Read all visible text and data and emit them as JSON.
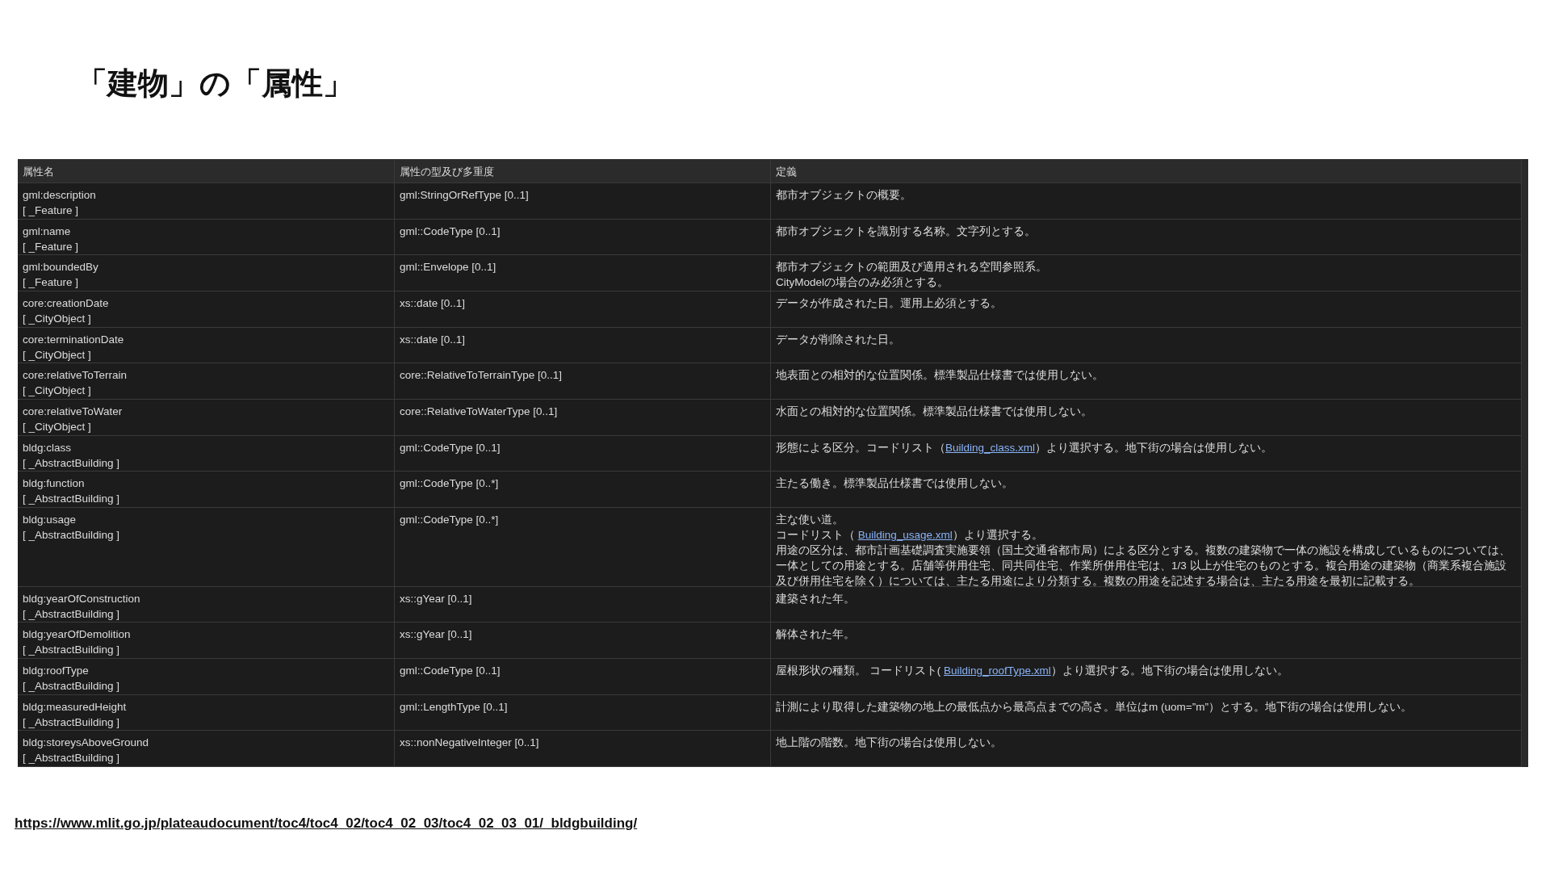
{
  "title": "「建物」の「属性」",
  "table": {
    "columns": [
      "属性名",
      "属性の型及び多重度",
      "定義"
    ],
    "rows": [
      {
        "name": "gml:description",
        "owner": "[ _Feature ]",
        "type": "gml:StringOrRefType [0..1]",
        "definition": [
          [
            {
              "text": "都市オブジェクトの概要。"
            }
          ]
        ]
      },
      {
        "name": "gml:name",
        "owner": "[ _Feature ]",
        "type": "gml::CodeType [0..1]",
        "definition": [
          [
            {
              "text": "都市オブジェクトを識別する名称。文字列とする。"
            }
          ]
        ]
      },
      {
        "name": "gml:boundedBy",
        "owner": "[ _Feature ]",
        "type": "gml::Envelope [0..1]",
        "definition": [
          [
            {
              "text": "都市オブジェクトの範囲及び適用される空間参照系。"
            }
          ],
          [
            {
              "text": "CityModelの場合のみ必須とする。"
            }
          ]
        ]
      },
      {
        "name": "core:creationDate",
        "owner": "[ _CityObject ]",
        "type": "xs::date [0..1]",
        "definition": [
          [
            {
              "text": "データが作成された日。運用上必須とする。"
            }
          ]
        ]
      },
      {
        "name": "core:terminationDate",
        "owner": "[ _CityObject ]",
        "type": "xs::date [0..1]",
        "definition": [
          [
            {
              "text": "データが削除された日。"
            }
          ]
        ]
      },
      {
        "name": "core:relativeToTerrain",
        "owner": "[ _CityObject ]",
        "type": "core::RelativeToTerrainType [0..1]",
        "definition": [
          [
            {
              "text": "地表面との相対的な位置関係。標準製品仕様書では使用しない。"
            }
          ]
        ]
      },
      {
        "name": "core:relativeToWater",
        "owner": "[ _CityObject ]",
        "type": "core::RelativeToWaterType [0..1]",
        "definition": [
          [
            {
              "text": "水面との相対的な位置関係。標準製品仕様書では使用しない。"
            }
          ]
        ]
      },
      {
        "name": "bldg:class",
        "owner": "[ _AbstractBuilding ]",
        "type": "gml::CodeType [0..1]",
        "definition": [
          [
            {
              "text": "形態による区分。コードリスト（"
            },
            {
              "text": "Building_class.xml",
              "kind": "link"
            },
            {
              "text": "）より選択する。地下街の場合は使用しない。"
            }
          ]
        ]
      },
      {
        "name": "bldg:function",
        "owner": "[ _AbstractBuilding ]",
        "type": "gml::CodeType [0..*]",
        "definition": [
          [
            {
              "text": "主たる働き。標準製品仕様書では使用しない。"
            }
          ]
        ]
      },
      {
        "name": "bldg:usage",
        "owner": "[ _AbstractBuilding ]",
        "type": "gml::CodeType [0..*]",
        "definition": [
          [
            {
              "text": "主な使い道。"
            }
          ],
          [
            {
              "text": "コードリスト（ "
            },
            {
              "text": "Building_usage.xml",
              "kind": "link"
            },
            {
              "text": "）より選択する。"
            }
          ],
          [
            {
              "text": "用途の区分は、都市計画基礎調査実施要領（国土交通省都市局）による区分とする。複数の建築物で一体の施設を構成しているものについては、一体としての用途とする。店舗等併用住宅、同共同住宅、作業所併用住宅は、1/3 以上が住宅のものとする。複合用途の建築物（商業系複合施設及び併用住宅を除く）については、主たる用途により分類する。複数の用途を記述する場合は、主たる用途を最初に記載する。"
            }
          ]
        ]
      },
      {
        "name": "bldg:yearOfConstruction",
        "owner": "[ _AbstractBuilding ]",
        "type": "xs::gYear [0..1]",
        "definition": [
          [
            {
              "text": "建築された年。"
            }
          ]
        ]
      },
      {
        "name": "bldg:yearOfDemolition",
        "owner": "[ _AbstractBuilding ]",
        "type": "xs::gYear [0..1]",
        "definition": [
          [
            {
              "text": "解体された年。"
            }
          ]
        ]
      },
      {
        "name": "bldg:roofType",
        "owner": "[ _AbstractBuilding ]",
        "type": "gml::CodeType [0..1]",
        "definition": [
          [
            {
              "text": "屋根形状の種類。 コードリスト( "
            },
            {
              "text": "Building_roofType.xml",
              "kind": "link"
            },
            {
              "text": "）より選択する。地下街の場合は使用しない。"
            }
          ]
        ]
      },
      {
        "name": "bldg:measuredHeight",
        "owner": "[ _AbstractBuilding ]",
        "type": "gml::LengthType [0..1]",
        "definition": [
          [
            {
              "text": "計測により取得した建築物の地上の最低点から最高点までの高さ。単位はm (uom=”m”）とする。地下街の場合は使用しない。"
            }
          ]
        ]
      },
      {
        "name": "bldg:storeysAboveGround",
        "owner": "[ _AbstractBuilding ]",
        "type": "xs::nonNegativeInteger [0..1]",
        "definition": [
          [
            {
              "text": "地上階の階数。地下街の場合は使用しない。"
            }
          ]
        ]
      }
    ]
  },
  "source_url": "https://www.mlit.go.jp/plateaudocument/toc4/toc4_02/toc4_02_03/toc4_02_03_01/_bldgbuilding/"
}
